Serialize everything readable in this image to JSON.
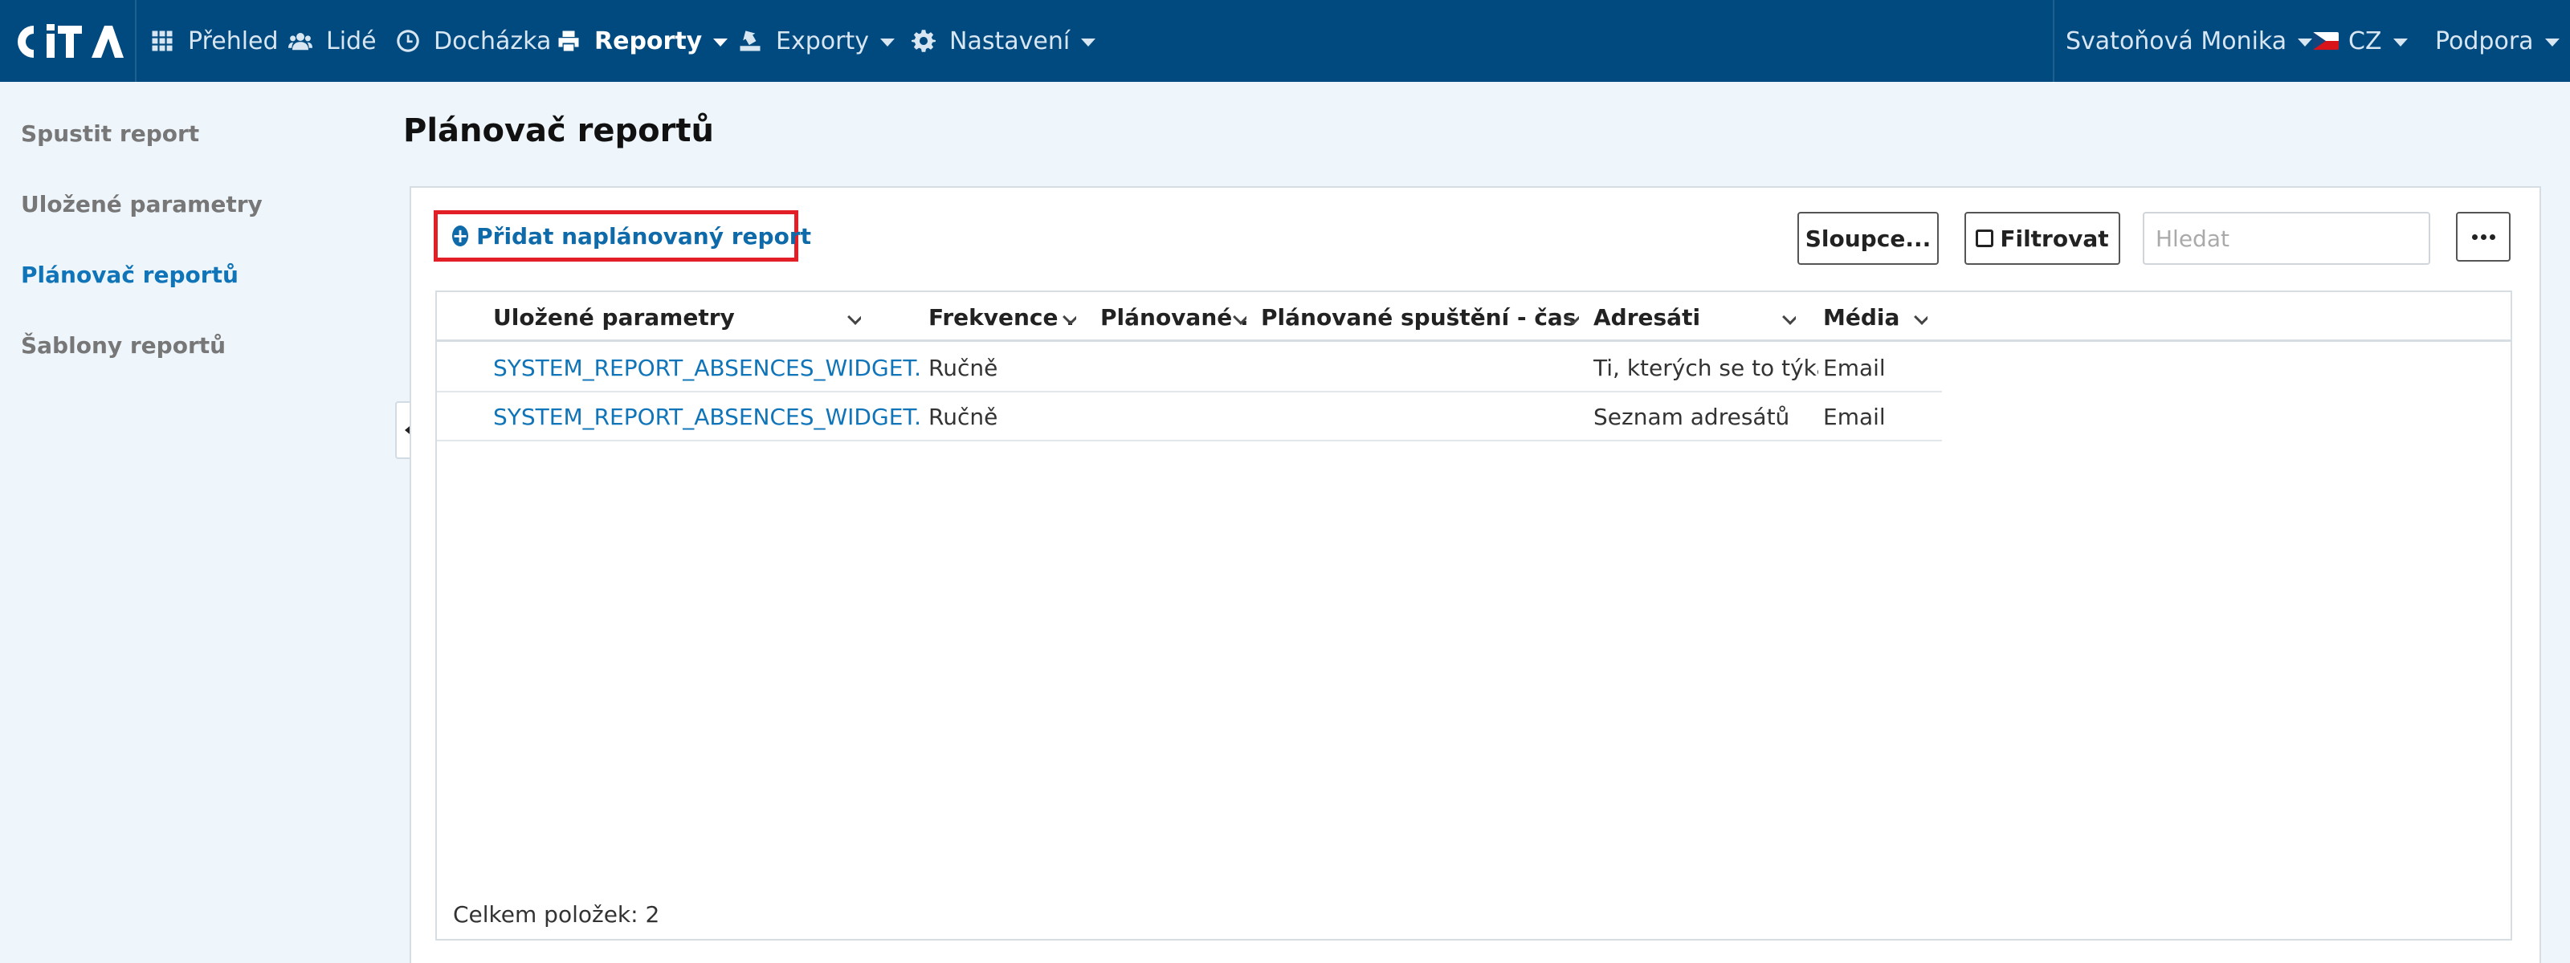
{
  "app": {
    "logo_text": "CITA",
    "colors": {
      "header_bg": "#004a80",
      "accent": "#1074b8",
      "highlight": "#e21e26"
    }
  },
  "nav": {
    "items": [
      {
        "label": "Přehled",
        "icon": "grid-icon"
      },
      {
        "label": "Lidé",
        "icon": "users-icon"
      },
      {
        "label": "Docházka",
        "icon": "clock-icon"
      },
      {
        "label": "Reporty",
        "icon": "printer-icon",
        "active": true
      },
      {
        "label": "Exporty",
        "icon": "export-icon"
      },
      {
        "label": "Nastavení",
        "icon": "gear-icon"
      }
    ],
    "user": "Svatoňová Monika",
    "language": "CZ",
    "support": "Podpora"
  },
  "sidebar": {
    "items": [
      {
        "label": "Spustit report"
      },
      {
        "label": "Uložené parametry"
      },
      {
        "label": "Plánovač reportů",
        "active": true
      },
      {
        "label": "Šablony reportů"
      }
    ]
  },
  "main": {
    "title": "Plánovač reportů",
    "add_button": "Přidat naplánovaný report",
    "columns_button": "Sloupce...",
    "filter_button": "Filtrovat",
    "search_placeholder": "Hledat"
  },
  "table": {
    "headers": [
      "Uložené parametry",
      "Frekvence ...",
      "Plánované ...",
      "Plánované spuštění - čas",
      "Adresáti",
      "Média"
    ],
    "rows": [
      [
        "SYSTEM_REPORT_ABSENCES_WIDGET...",
        "Ručně",
        "",
        "",
        "Ti, kterých se to týká",
        "Email"
      ],
      [
        "SYSTEM_REPORT_ABSENCES_WIDGET...",
        "Ručně",
        "",
        "",
        "Seznam adresátů",
        "Email"
      ]
    ],
    "total_label": "Celkem položek: 2"
  }
}
